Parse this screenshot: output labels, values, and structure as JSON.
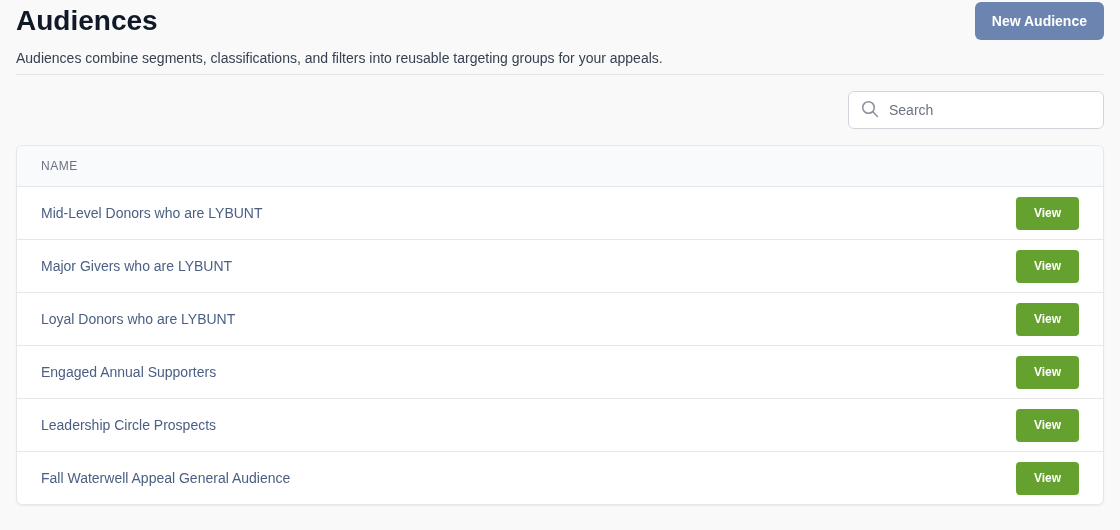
{
  "header": {
    "title": "Audiences",
    "description": "Audiences combine segments, classifications, and filters into reusable targeting groups for your appeals.",
    "new_button": "New Audience"
  },
  "search": {
    "placeholder": "Search"
  },
  "table": {
    "columns": [
      "NAME"
    ],
    "rows": [
      {
        "name": "Mid-Level Donors who are LYBUNT",
        "action": "View"
      },
      {
        "name": "Major Givers who are LYBUNT",
        "action": "View"
      },
      {
        "name": "Loyal Donors who are LYBUNT",
        "action": "View"
      },
      {
        "name": "Engaged Annual Supporters",
        "action": "View"
      },
      {
        "name": "Leadership Circle Prospects",
        "action": "View"
      },
      {
        "name": "Fall Waterwell Appeal General Audience",
        "action": "View"
      }
    ]
  }
}
